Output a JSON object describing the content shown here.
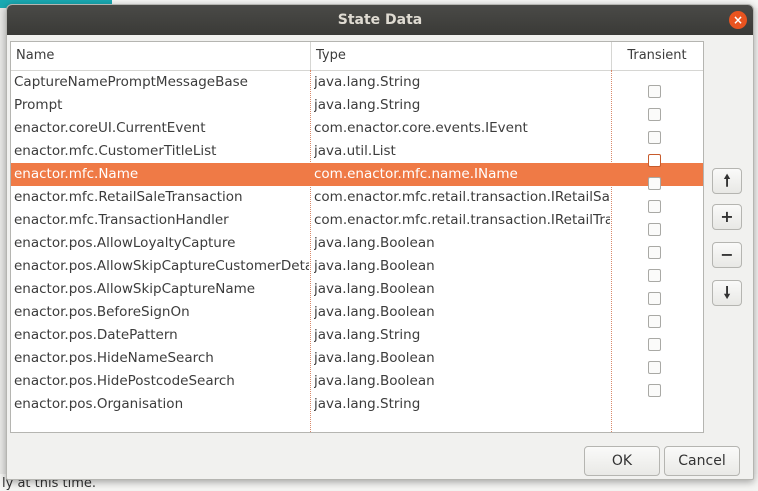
{
  "background": {
    "bottom_text": "ly at this time."
  },
  "dialog": {
    "title": "State Data",
    "close_glyph": "×",
    "columns": [
      "Name",
      "Type",
      "Transient"
    ],
    "rows": [
      {
        "name": "CaptureNamePromptMessageBase",
        "type": "java.lang.String",
        "transient": false,
        "has_checkbox": false
      },
      {
        "name": "Prompt",
        "type": "java.lang.String",
        "transient": false,
        "has_checkbox": true
      },
      {
        "name": "enactor.coreUI.CurrentEvent",
        "type": "com.enactor.core.events.IEvent",
        "transient": false,
        "has_checkbox": true
      },
      {
        "name": "enactor.mfc.CustomerTitleList",
        "type": "java.util.List",
        "transient": false,
        "has_checkbox": true
      },
      {
        "name": "enactor.mfc.Name",
        "type": "com.enactor.mfc.name.IName",
        "transient": false,
        "has_checkbox": true,
        "selected": true
      },
      {
        "name": "enactor.mfc.RetailSaleTransaction",
        "type": "com.enactor.mfc.retail.transaction.IRetailSaleTransaction",
        "transient": false,
        "has_checkbox": true
      },
      {
        "name": "enactor.mfc.TransactionHandler",
        "type": "com.enactor.mfc.retail.transaction.IRetailTransactionHandler",
        "transient": false,
        "has_checkbox": true
      },
      {
        "name": "enactor.pos.AllowLoyaltyCapture",
        "type": "java.lang.Boolean",
        "transient": false,
        "has_checkbox": true
      },
      {
        "name": "enactor.pos.AllowSkipCaptureCustomerDetails",
        "type": "java.lang.Boolean",
        "transient": false,
        "has_checkbox": true
      },
      {
        "name": "enactor.pos.AllowSkipCaptureName",
        "type": "java.lang.Boolean",
        "transient": false,
        "has_checkbox": true
      },
      {
        "name": "enactor.pos.BeforeSignOn",
        "type": "java.lang.Boolean",
        "transient": false,
        "has_checkbox": true
      },
      {
        "name": "enactor.pos.DatePattern",
        "type": "java.lang.String",
        "transient": false,
        "has_checkbox": true
      },
      {
        "name": "enactor.pos.HideNameSearch",
        "type": "java.lang.Boolean",
        "transient": false,
        "has_checkbox": true
      },
      {
        "name": "enactor.pos.HidePostcodeSearch",
        "type": "java.lang.Boolean",
        "transient": false,
        "has_checkbox": true
      },
      {
        "name": "enactor.pos.Organisation",
        "type": "java.lang.String",
        "transient": false,
        "has_checkbox": true
      }
    ],
    "side_buttons": [
      {
        "name": "move-up-button",
        "glyph": "🠕",
        "icon": "arrow-up-icon"
      },
      {
        "name": "add-row-button",
        "glyph": "+",
        "icon": "plus-icon"
      },
      {
        "name": "remove-row-button",
        "glyph": "−",
        "icon": "minus-icon"
      },
      {
        "name": "move-down-button",
        "glyph": "🠗",
        "icon": "arrow-down-icon"
      }
    ],
    "ok_label": "OK",
    "cancel_label": "Cancel",
    "colors": {
      "selection": "#ef7a46",
      "accent": "#e95420",
      "titlebar": "#3f3f3c"
    }
  }
}
